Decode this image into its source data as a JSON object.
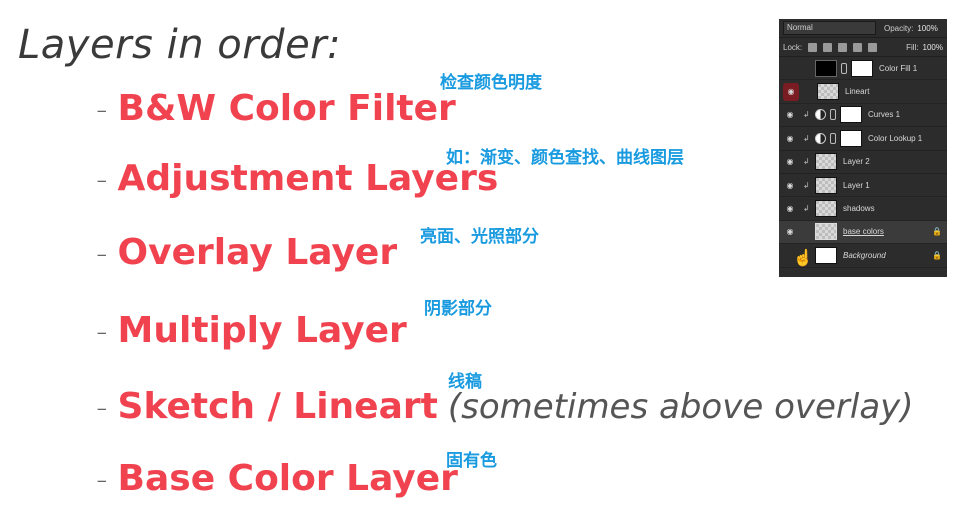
{
  "title": "Layers in order:",
  "items": [
    {
      "label": "B&W Color Filter",
      "note": "检查颜色明度"
    },
    {
      "label": "Adjustment Layers",
      "note": "如：渐变、颜色查找、曲线图层"
    },
    {
      "label": "Overlay Layer",
      "note": "亮面、光照部分"
    },
    {
      "label": "Multiply Layer",
      "note": "阴影部分"
    },
    {
      "label": "Sketch / Lineart",
      "extra": "(sometimes above overlay)",
      "note": "线稿"
    },
    {
      "label": "Base Color Layer",
      "note": "固有色"
    }
  ],
  "dash": "-",
  "panel": {
    "blend_mode": "Normal",
    "opacity_label": "Opacity:",
    "opacity_value": "100%",
    "lock_label": "Lock:",
    "fill_label": "Fill:",
    "fill_value": "100%",
    "layers": [
      {
        "name": "Color Fill 1"
      },
      {
        "name": "Lineart"
      },
      {
        "name": "Curves 1"
      },
      {
        "name": "Color Lookup 1"
      },
      {
        "name": "Layer 2"
      },
      {
        "name": "Layer 1"
      },
      {
        "name": "shadows"
      },
      {
        "name": "base colors"
      },
      {
        "name": "Background"
      }
    ]
  },
  "colors": {
    "accent_red": "#f0434f",
    "note_blue": "#1a9be0",
    "panel_bg": "#2c2c2c"
  }
}
